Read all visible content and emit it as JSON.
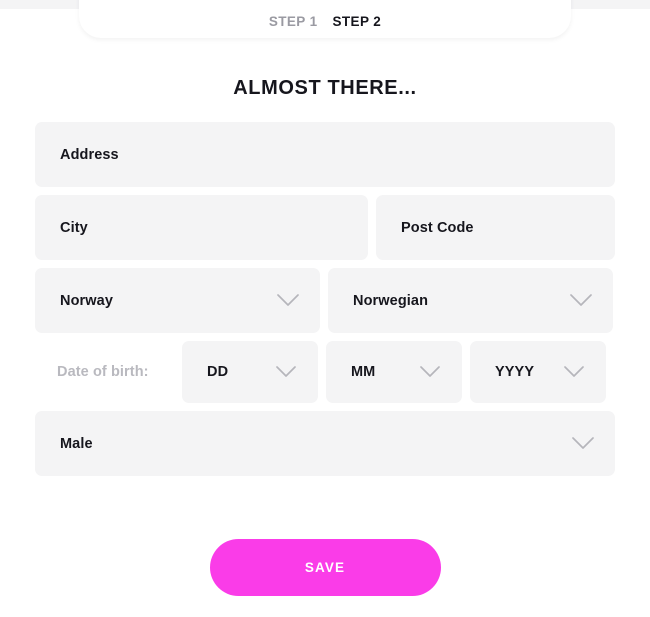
{
  "theme": {
    "page_background": "#ffffff",
    "field_background": "#f4f4f5",
    "text_color": "#16161d",
    "muted_text_color": "#b9b9bf",
    "inactive_tab_color": "#9a9aa2",
    "accent_color": "#fa3ce8",
    "accent_text_color": "#ffffff"
  },
  "stepper": {
    "tabs": [
      {
        "label": "STEP 1",
        "state": "inactive"
      },
      {
        "label": "STEP 2",
        "state": "active"
      }
    ]
  },
  "heading": "ALMOST THERE...",
  "form": {
    "address": {
      "value": "Address",
      "placeholder": "Address"
    },
    "city": {
      "value": "City",
      "placeholder": "City"
    },
    "post_code": {
      "value": "Post Code",
      "placeholder": "Post Code"
    },
    "country": {
      "value": "Norway",
      "icon": "chevron-down-icon"
    },
    "language": {
      "value": "Norwegian",
      "icon": "chevron-down-icon"
    },
    "date_of_birth": {
      "label": "Date of birth:",
      "day": {
        "value": "DD",
        "icon": "chevron-down-icon"
      },
      "month": {
        "value": "MM",
        "icon": "chevron-down-icon"
      },
      "year": {
        "value": "YYYY",
        "icon": "chevron-down-icon"
      }
    },
    "gender": {
      "value": "Male",
      "icon": "chevron-down-icon"
    }
  },
  "actions": {
    "save_label": "SAVE"
  }
}
